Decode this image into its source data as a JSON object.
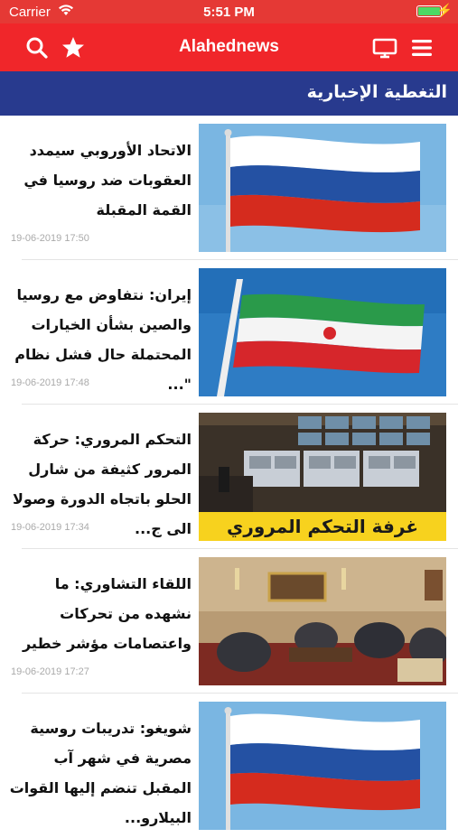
{
  "status_bar": {
    "carrier": "Carrier",
    "time": "5:51 PM",
    "battery_level": 1.0
  },
  "nav": {
    "title": "Alahednews",
    "icons": [
      "search-icon",
      "star-icon",
      "tv-icon",
      "menu-icon"
    ]
  },
  "section": {
    "title": "التغطية الإخبارية"
  },
  "articles": [
    {
      "headline": "الاتحاد الأوروبي سيمدد العقوبات ضد روسيا في القمة المقبلة",
      "date": "19-06-2019 17:50",
      "image": "russia-flag"
    },
    {
      "headline": "إيران: نتفاوض مع روسيا والصين بشأن الخيارات المحتملة حال فشل نظام \"...",
      "date": "19-06-2019 17:48",
      "image": "iran-flag"
    },
    {
      "headline": "التحكم المروري: حركة المرور كثيفة من شارل الحلو باتجاه الدورة وصولا الى ج...",
      "date": "19-06-2019 17:34",
      "image": "traffic-control-room",
      "image_caption": "غرفة التحكم المروري"
    },
    {
      "headline": "اللقاء التشاوري: ما نشهده من تحركات واعتصامات مؤشر خطير",
      "date": "19-06-2019 17:27",
      "image": "meeting-room"
    },
    {
      "headline": "شويغو: تدريبات روسية مصرية في شهر آب المقبل تنضم إليها القوات البيلارو...",
      "date": "",
      "image": "russia-flag"
    }
  ],
  "colors": {
    "nav_bg": "#f0262a",
    "section_bg": "#283a8e",
    "battery": "#4cd964"
  }
}
